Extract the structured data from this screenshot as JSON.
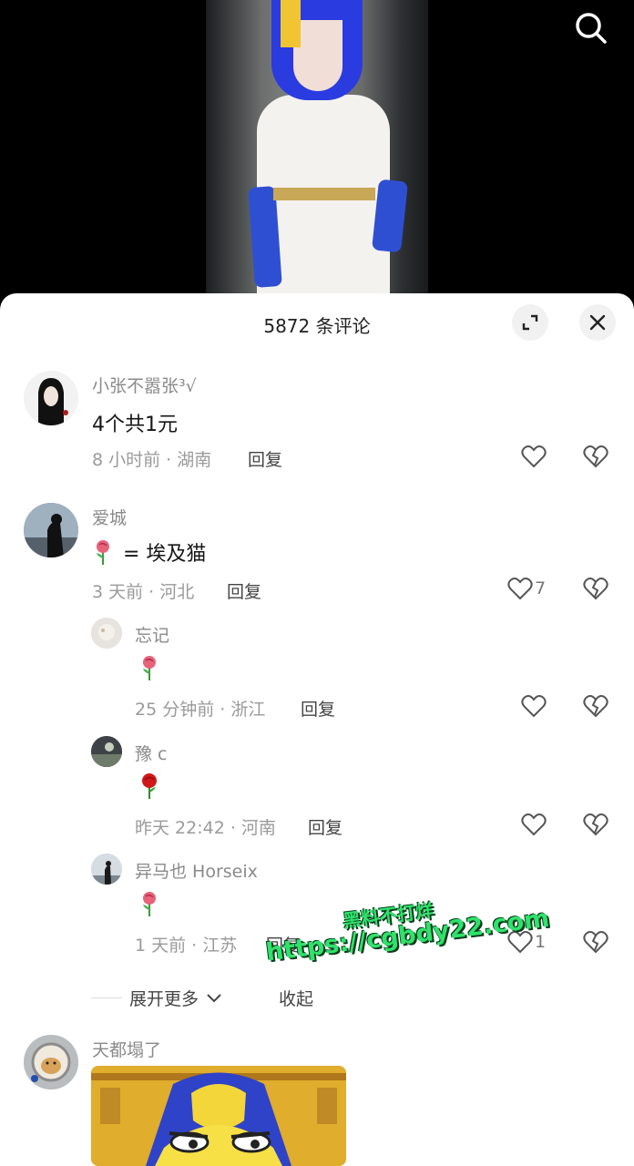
{
  "header": {
    "title": "5872 条评论"
  },
  "comments": [
    {
      "username": "小张不嚣张³√",
      "text": "4个共1元",
      "meta": "8 小时前 · 湖南",
      "reply_label": "回复",
      "likes": null,
      "replies": []
    },
    {
      "username": "爱城",
      "text": "= 埃及猫",
      "text_prefix_icon": "rose-icon",
      "meta": "3 天前 · 河北",
      "reply_label": "回复",
      "likes": "7",
      "replies": [
        {
          "username": "忘记",
          "icon": "rose-icon",
          "meta": "25 分钟前 · 浙江",
          "reply_label": "回复",
          "likes": null
        },
        {
          "username": "豫 c",
          "icon": "red-rose-icon",
          "meta": "昨天 22:42 · 河南",
          "reply_label": "回复",
          "likes": null
        },
        {
          "username": "异马也 Horseix",
          "icon": "rose-icon",
          "meta": "1 天前 · 江苏",
          "reply_label": "回复",
          "likes": "1"
        }
      ]
    },
    {
      "username": "天都塌了",
      "image": "anubis-cat-meme-image"
    }
  ],
  "thread": {
    "expand_more_label": "展开更多",
    "collapse_label": "收起"
  },
  "watermark": {
    "line1": "黑料不打烊",
    "line2": "https://cgbdy22.com"
  },
  "colors": {
    "sheet_bg": "#ffffff",
    "username": "#8a8a8a",
    "meta": "#9a9a9a",
    "watermark": "#2fe26a"
  },
  "icons": [
    "search-icon",
    "expand-icon",
    "close-icon",
    "heart-icon",
    "broken-heart-icon",
    "rose-icon",
    "chevron-down-icon"
  ]
}
